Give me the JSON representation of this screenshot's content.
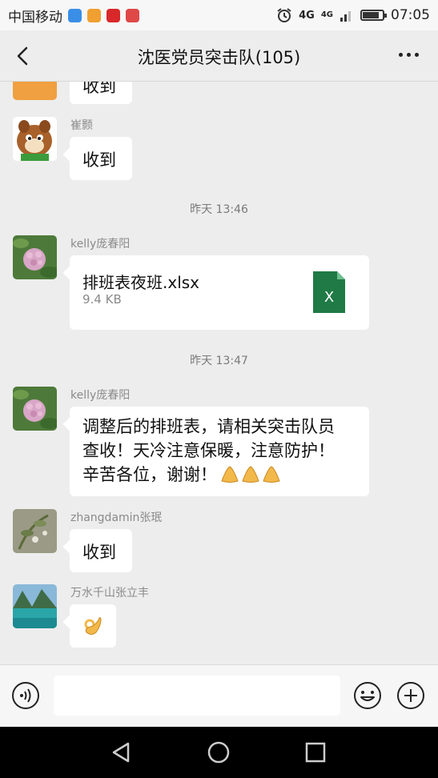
{
  "status_bar": {
    "carrier": "中国移动",
    "network_1": "4G",
    "network_2": "4G",
    "time": "07:05",
    "battery_level": 0.85
  },
  "header": {
    "title": "沈医党员突击队(105)",
    "back_icon": "chevron-left-icon",
    "more_icon": "more-dots-icon"
  },
  "messages": [
    {
      "type": "text",
      "sender": "",
      "text": "收到",
      "avatar_icon": "orange-avatar"
    },
    {
      "type": "text",
      "sender": "崔颢",
      "text": "收到",
      "avatar_icon": "chipmunk-avatar"
    },
    {
      "type": "time",
      "text": "昨天 13:46"
    },
    {
      "type": "file",
      "sender": "kelly庞春阳",
      "file_name": "排班表夜班.xlsx",
      "file_size": "9.4 KB",
      "file_icon_letter": "X",
      "file_icon_color": "#1f7a45",
      "avatar_icon": "flower-avatar"
    },
    {
      "type": "time",
      "text": "昨天 13:47"
    },
    {
      "type": "text",
      "sender": "kelly庞春阳",
      "text_lines": [
        "调整后的排班表，请相关突击队员",
        "查收！天冷注意保暖，注意防护！",
        "辛苦各位，谢谢！"
      ],
      "emoji_icon": "praying-hands-emoji",
      "avatar_icon": "flower-avatar"
    },
    {
      "type": "text",
      "sender": "zhangdamin张珉",
      "text": "收到",
      "avatar_icon": "plant-avatar"
    },
    {
      "type": "emoji",
      "sender": "万水千山张立丰",
      "emoji_icon": "ok-hand-emoji",
      "avatar_icon": "lake-avatar"
    }
  ],
  "input_bar": {
    "voice_icon": "voice-icon",
    "placeholder": "",
    "emoji_icon": "smiley-icon",
    "plus_icon": "plus-icon"
  },
  "nav_bar": {
    "back_icon": "triangle-back-icon",
    "home_icon": "circle-home-icon",
    "recent_icon": "square-recent-icon"
  },
  "colors": {
    "background": "#ededed",
    "bubble": "#ffffff",
    "excel_green": "#1f7a45"
  }
}
